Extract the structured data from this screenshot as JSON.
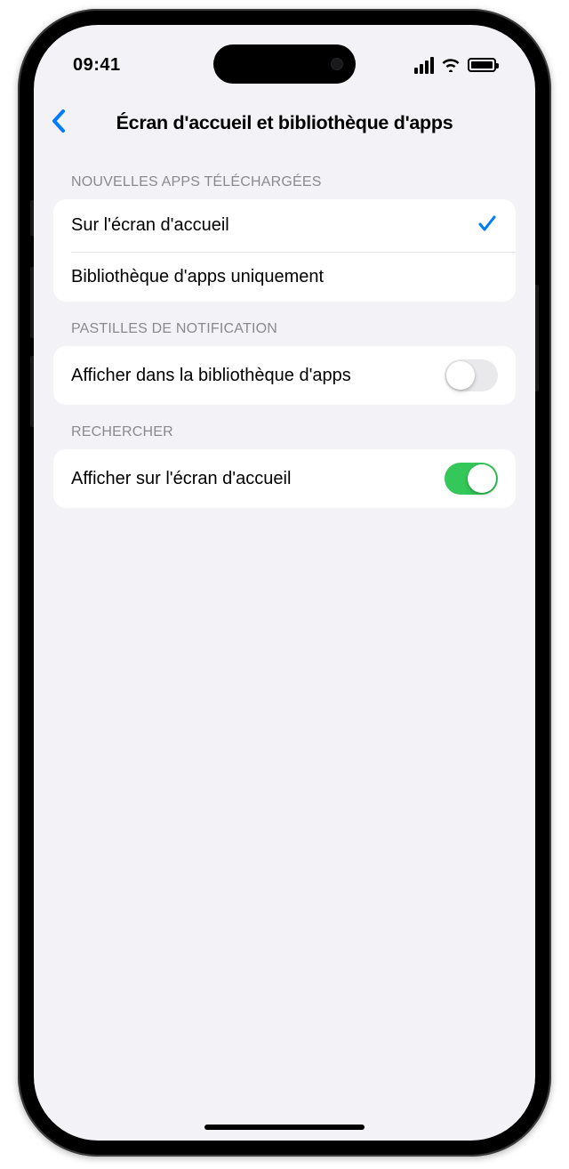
{
  "status": {
    "time": "09:41"
  },
  "nav": {
    "title": "Écran d'accueil et bibliothèque d'apps"
  },
  "sections": {
    "new_apps": {
      "header": "NOUVELLES APPS TÉLÉCHARGÉES",
      "options": [
        {
          "label": "Sur l'écran d'accueil",
          "selected": true
        },
        {
          "label": "Bibliothèque d'apps uniquement",
          "selected": false
        }
      ]
    },
    "badges": {
      "header": "PASTILLES DE NOTIFICATION",
      "item": {
        "label": "Afficher dans la bibliothèque d'apps",
        "enabled": false
      }
    },
    "search": {
      "header": "RECHERCHER",
      "item": {
        "label": "Afficher sur l'écran d'accueil",
        "enabled": true
      }
    }
  }
}
